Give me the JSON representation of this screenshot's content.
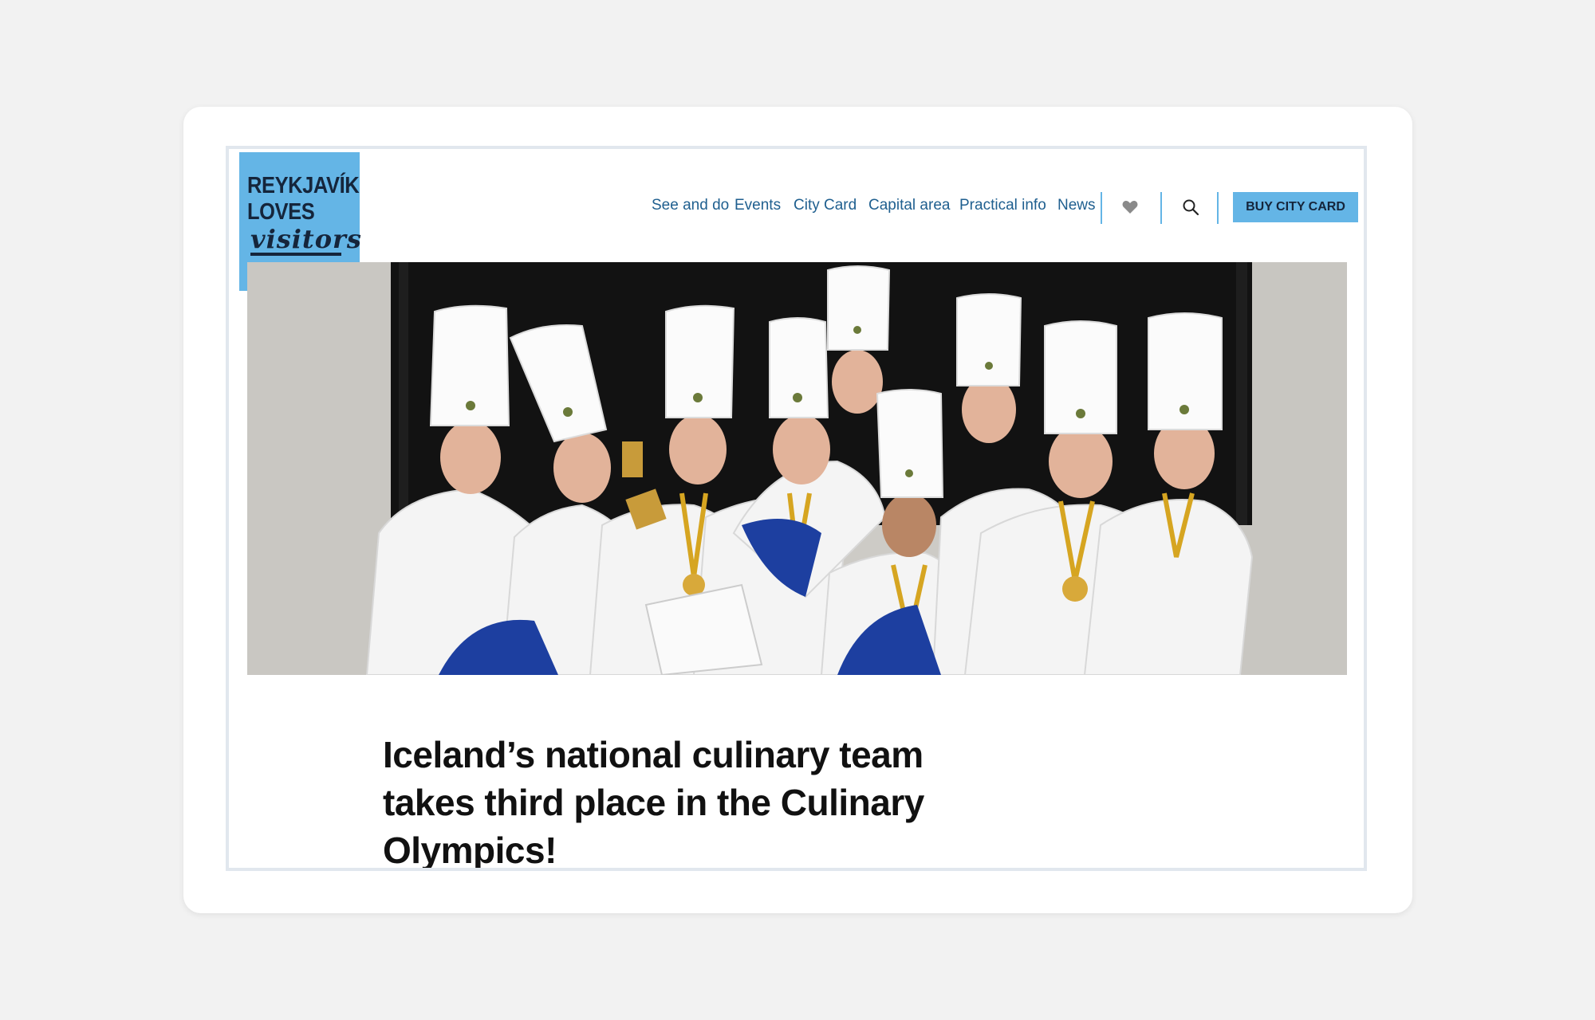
{
  "logo": {
    "line1": "REYKJAVÍK",
    "line2": "LOVES",
    "script": "visitors"
  },
  "nav": {
    "items": [
      {
        "label": "See and do"
      },
      {
        "label": "Events"
      },
      {
        "label": "City Card"
      },
      {
        "label": "Capital area"
      },
      {
        "label": "Practical info"
      },
      {
        "label": "News"
      }
    ],
    "favorites_icon": "heart-icon",
    "search_icon": "search-icon",
    "cta_label": "BUY CITY CARD"
  },
  "hero": {
    "image": "culinary-team-photo",
    "description_icon": "photo"
  },
  "article": {
    "title": "Iceland’s national culinary team takes third place in the Culinary Olympics!"
  },
  "colors": {
    "brand_blue": "#64b5e6",
    "nav_text": "#1f5f8f",
    "dark_navy": "#15253b",
    "page_bg": "#f2f2f2"
  }
}
